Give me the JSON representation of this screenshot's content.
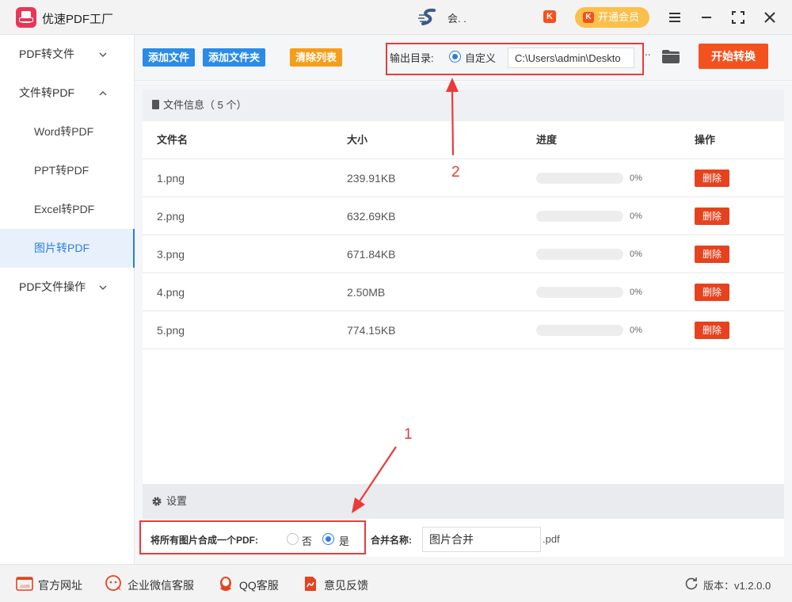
{
  "titlebar": {
    "app_title": "优速PDF工厂",
    "user_name": "会. .",
    "vip_label": "开通会员",
    "brand_icon_text": "K"
  },
  "sidebar": {
    "groups": [
      {
        "label": "PDF转文件"
      },
      {
        "label": "文件转PDF"
      },
      {
        "label": "PDF文件操作"
      }
    ],
    "items": [
      {
        "label": "Word转PDF"
      },
      {
        "label": "PPT转PDF"
      },
      {
        "label": "Excel转PDF"
      },
      {
        "label": "图片转PDF"
      }
    ],
    "active_item": "图片转PDF"
  },
  "toolbar": {
    "add_file": "添加文件",
    "add_folder": "添加文件夹",
    "clear_list": "清除列表",
    "output_label": "输出目录:",
    "custom_label": "自定义",
    "output_path": "C:\\Users\\admin\\Deskto",
    "more": "···",
    "start": "开始转换"
  },
  "file_panel": {
    "header": "文件信息（ 5 个）",
    "columns": [
      "文件名",
      "大小",
      "进度",
      "操作"
    ],
    "delete_label": "删除",
    "rows": [
      {
        "name": "1.png",
        "size": "239.91KB",
        "progress": 0,
        "pct": "0%"
      },
      {
        "name": "2.png",
        "size": "632.69KB",
        "progress": 0,
        "pct": "0%"
      },
      {
        "name": "3.png",
        "size": "671.84KB",
        "progress": 0,
        "pct": "0%"
      },
      {
        "name": "4.png",
        "size": "2.50MB",
        "progress": 0,
        "pct": "0%"
      },
      {
        "name": "5.png",
        "size": "774.15KB",
        "progress": 0,
        "pct": "0%"
      }
    ]
  },
  "settings": {
    "title": "设置",
    "merge_label": "将所有图片合成一个PDF:",
    "no_label": "否",
    "yes_label": "是",
    "merge_selected": "是",
    "name_label": "合并名称:",
    "name_value": "图片合并",
    "ext": ".pdf"
  },
  "footer": {
    "website": "官方网址",
    "wechat": "企业微信客服",
    "qq": "QQ客服",
    "feedback": "意见反馈",
    "version": "版本：v1.2.0.0",
    "website_icon_text": ".com"
  },
  "annotations": {
    "label_1": "1",
    "label_2": "2",
    "color": "#ea3a3a"
  },
  "colors": {
    "primary_blue": "#2b8be6",
    "accent_orange": "#f4511e",
    "clear_orange": "#f59e19",
    "vip_yellow": "#fbc04b"
  }
}
